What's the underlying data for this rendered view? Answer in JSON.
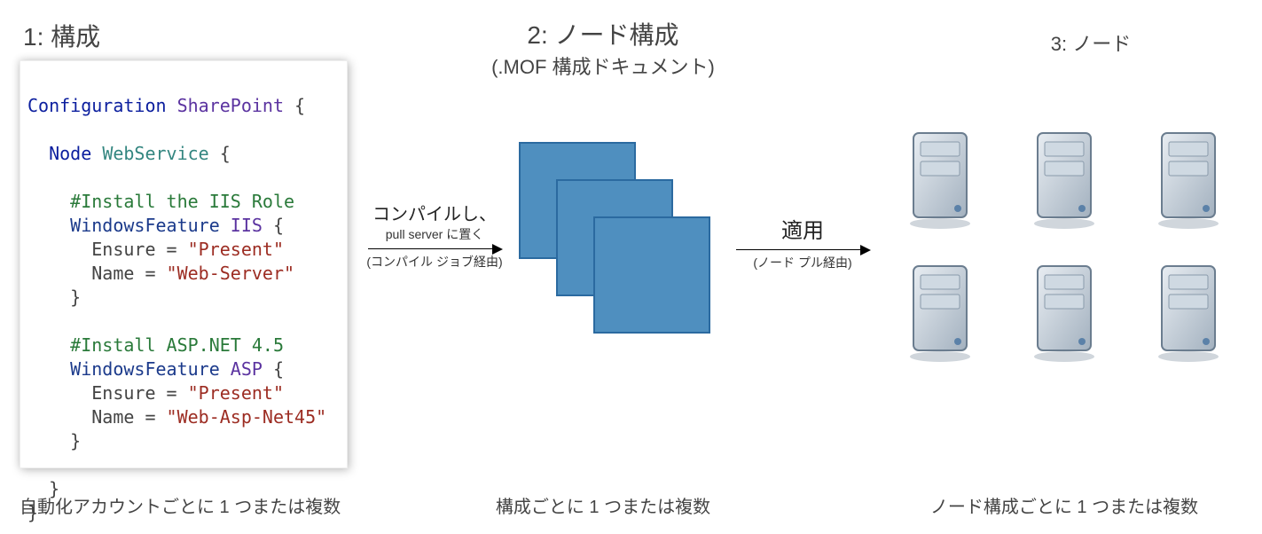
{
  "col1": {
    "heading": "1: 構成",
    "caption": "自動化アカウントごとに 1 つまたは複数",
    "code": {
      "l1_kw": "Configuration",
      "l1_name": "SharePoint",
      "l1_brace": " {",
      "l2_kw": "Node",
      "l2_name": "WebService",
      "l2_brace": " {",
      "c1": "#Install the IIS Role",
      "wf": "WindowsFeature",
      "iis_name": "IIS",
      "block_open": " {",
      "ensure_key": "Ensure = ",
      "present": "\"Present\"",
      "name_key": "Name = ",
      "webserver": "\"Web-Server\"",
      "brace_close": "}",
      "c2": "#Install ASP.NET 4.5",
      "asp_name": "ASP",
      "aspnet": "\"Web-Asp-Net45\""
    }
  },
  "col2": {
    "heading": "2: ノード構成",
    "sub": "(.MOF 構成ドキュメント)",
    "caption": "構成ごとに 1 つまたは複数"
  },
  "col3": {
    "heading": "3: ノード",
    "caption": "ノード構成ごとに 1 つまたは複数"
  },
  "arrow1": {
    "line1": "コンパイルし、",
    "line2": "pull server に置く",
    "below": "(コンパイル ジョブ経由)"
  },
  "arrow2": {
    "line1": "適用",
    "below": "(ノード プル経由)"
  }
}
